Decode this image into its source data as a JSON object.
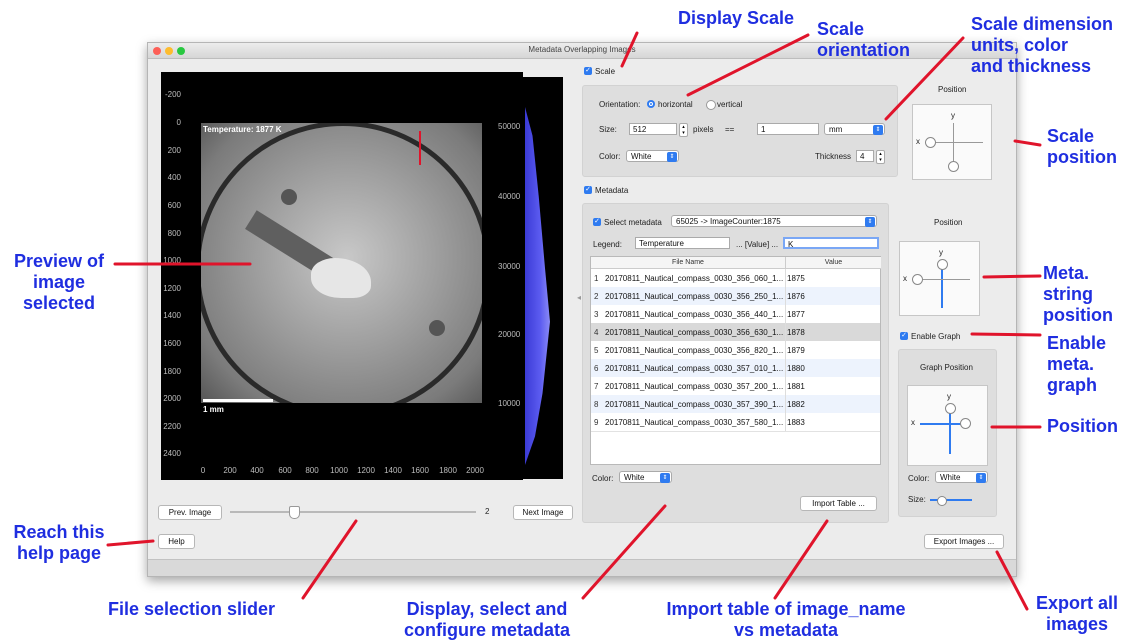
{
  "window": {
    "title": "Metadata Overlapping Images"
  },
  "preview": {
    "temperature_label": "Temperature: 1877 K",
    "scale_label": "1 mm",
    "y_ticks": [
      "-200",
      "0",
      "200",
      "400",
      "600",
      "800",
      "1000",
      "1200",
      "1400",
      "1600",
      "1800",
      "2000",
      "2200",
      "2400"
    ],
    "x_ticks": [
      "0",
      "200",
      "400",
      "600",
      "800",
      "1000",
      "1200",
      "1400",
      "1600",
      "1800",
      "2000"
    ],
    "histogram_ticks": [
      "50000",
      "40000",
      "30000",
      "20000",
      "10000"
    ]
  },
  "nav": {
    "prev_label": "Prev. Image",
    "next_label": "Next Image",
    "slider_value": "2",
    "help_label": "Help"
  },
  "scale": {
    "checkbox_label": "Scale",
    "orientation_label": "Orientation:",
    "horizontal_label": "horizontal",
    "vertical_label": "vertical",
    "size_label": "Size:",
    "size_value": "512",
    "pixels_label": "pixels",
    "equals_label": "==",
    "units_value": "1",
    "units_select": "mm",
    "color_label": "Color:",
    "color_value": "White",
    "thickness_label": "Thickness",
    "thickness_value": "4",
    "position_title": "Position"
  },
  "metadata": {
    "checkbox_label": "Metadata",
    "select_label": "Select metadata",
    "select_value": "65025 -> ImageCounter:1875",
    "legend_label": "Legend:",
    "legend_value": "Temperature",
    "value_placeholder_label": "... [Value] ...",
    "unit_value": "K",
    "columns": [
      "File Name",
      "Value"
    ],
    "rows": [
      {
        "n": "1",
        "file": "20170811_Nautical_compass_0030_356_060_1...",
        "value": "1875"
      },
      {
        "n": "2",
        "file": "20170811_Nautical_compass_0030_356_250_1...",
        "value": "1876"
      },
      {
        "n": "3",
        "file": "20170811_Nautical_compass_0030_356_440_1...",
        "value": "1877"
      },
      {
        "n": "4",
        "file": "20170811_Nautical_compass_0030_356_630_1...",
        "value": "1878"
      },
      {
        "n": "5",
        "file": "20170811_Nautical_compass_0030_356_820_1...",
        "value": "1879"
      },
      {
        "n": "6",
        "file": "20170811_Nautical_compass_0030_357_010_1...",
        "value": "1880"
      },
      {
        "n": "7",
        "file": "20170811_Nautical_compass_0030_357_200_1...",
        "value": "1881"
      },
      {
        "n": "8",
        "file": "20170811_Nautical_compass_0030_357_390_1...",
        "value": "1882"
      },
      {
        "n": "9",
        "file": "20170811_Nautical_compass_0030_357_580_1...",
        "value": "1883"
      }
    ],
    "color_label": "Color:",
    "color_value": "White",
    "import_label": "Import Table ...",
    "position_title": "Position"
  },
  "graph": {
    "checkbox_label": "Enable Graph",
    "position_title": "Graph Position",
    "color_label": "Color:",
    "color_value": "White",
    "size_label": "Size:"
  },
  "export_label": "Export Images ...",
  "axis_letters": {
    "x": "x",
    "y": "y"
  },
  "annotations": {
    "display_scale": "Display Scale",
    "scale_orientation": [
      "Scale",
      "orientation"
    ],
    "scale_dimension": [
      "Scale dimension",
      "units, color",
      "and thickness"
    ],
    "scale_position": [
      "Scale",
      "position"
    ],
    "preview": [
      "Preview of",
      "image",
      "selected"
    ],
    "meta_string_position": [
      "Meta.",
      "string",
      "position"
    ],
    "enable_meta_graph": [
      "Enable",
      "meta.",
      "graph"
    ],
    "position": "Position",
    "reach_help": [
      "Reach this",
      "help page"
    ],
    "file_slider": "File selection slider",
    "display_metadata": [
      "Display, select and",
      "configure metadata"
    ],
    "import_table": [
      "Import table of image_name",
      "vs metadata"
    ],
    "export_all": [
      "Export all",
      "images"
    ]
  },
  "colors": {
    "accent": "#2f7bf0",
    "annotation": "#1f2ee0",
    "arrow": "#e0142b"
  }
}
